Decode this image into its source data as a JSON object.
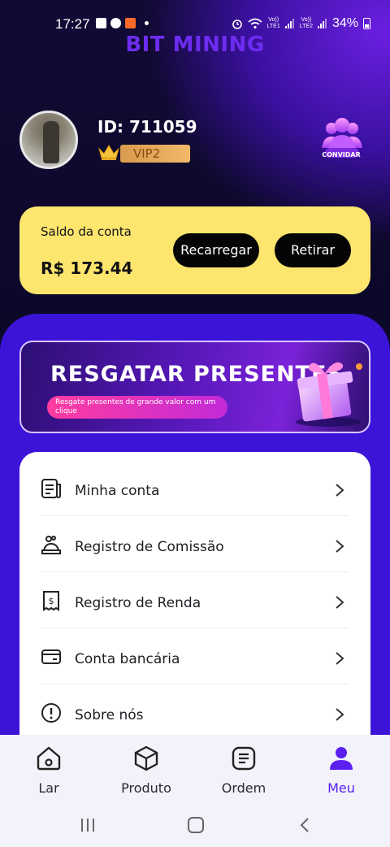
{
  "status_bar": {
    "time": "17:27",
    "sim1": "Vo))\nLTE1",
    "sim2": "Vo))\nLTE2",
    "battery": "34%"
  },
  "brand": "BIT MINING",
  "profile": {
    "id_text": "ID: 711059",
    "vip_level": "VIP2",
    "invite_label": "CONVIDAR",
    "avatar_icon": "avatar-photo"
  },
  "balance": {
    "label": "Saldo da conta",
    "value": "R$ 173.44",
    "recharge_button": "Recarregar",
    "withdraw_button": "Retirar"
  },
  "banner": {
    "title": "RESGATAR PRESENTES",
    "subtitle": "Resgate presentes de grande valor com um clique",
    "icon": "gift-box-icon"
  },
  "menu": {
    "items": [
      {
        "label": "Minha conta",
        "icon": "account-document-icon"
      },
      {
        "label": "Registro de Comissão",
        "icon": "commission-hand-icon"
      },
      {
        "label": "Registro de Renda",
        "icon": "income-receipt-icon"
      },
      {
        "label": "Conta bancária",
        "icon": "bank-card-icon"
      },
      {
        "label": "Sobre nós",
        "icon": "info-icon"
      }
    ]
  },
  "tabs": [
    {
      "label": "Lar",
      "icon": "home-icon"
    },
    {
      "label": "Produto",
      "icon": "box-icon"
    },
    {
      "label": "Ordem",
      "icon": "list-icon"
    },
    {
      "label": "Meu",
      "icon": "user-icon",
      "active": true
    }
  ],
  "colors": {
    "accent": "#5b1ff0",
    "balance_card": "#fde56e",
    "panel": "#3c14d8",
    "vip_badge": "#f2b86a"
  }
}
